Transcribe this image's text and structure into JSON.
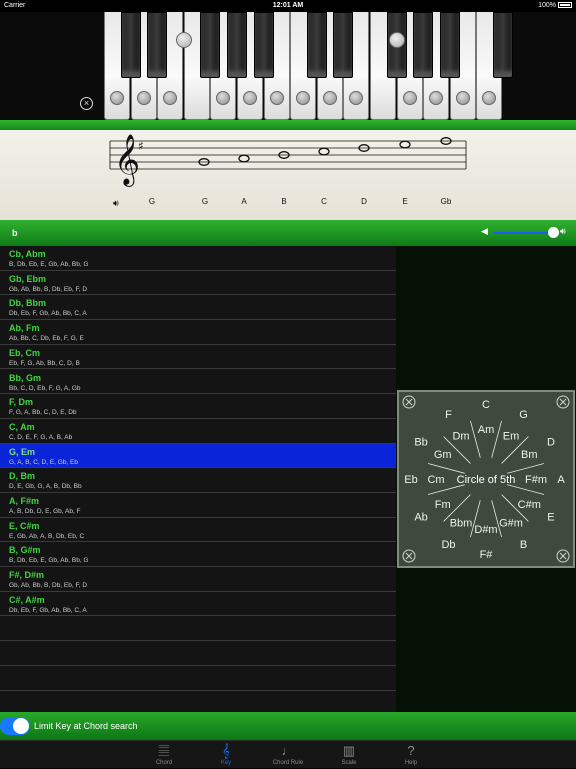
{
  "status_bar": {
    "carrier": "Carrier",
    "time": "12:01 AM",
    "battery": "100%"
  },
  "staff": {
    "notes": [
      "G",
      "G",
      "A",
      "B",
      "C",
      "D",
      "E",
      "Gb"
    ]
  },
  "key_bar": {
    "selected_key": "b"
  },
  "key_list": [
    {
      "title": "Cb, Abm",
      "notes": "B, Db, Eb, E, Gb, Ab, Bb, G",
      "selected": false
    },
    {
      "title": "Gb, Ebm",
      "notes": "Gb, Ab, Bb, B, Db, Eb, F, D",
      "selected": false
    },
    {
      "title": "Db, Bbm",
      "notes": "Db, Eb, F, Gb, Ab, Bb, C, A",
      "selected": false
    },
    {
      "title": "Ab, Fm",
      "notes": "Ab, Bb, C, Db, Eb, F, G, E",
      "selected": false
    },
    {
      "title": "Eb, Cm",
      "notes": "Eb, F, G, Ab, Bb, C, D, B",
      "selected": false
    },
    {
      "title": "Bb, Gm",
      "notes": "Bb, C, D, Eb, F, G, A, Gb",
      "selected": false
    },
    {
      "title": "F, Dm",
      "notes": "F, G, A, Bb, C, D, E, Db",
      "selected": false
    },
    {
      "title": "C, Am",
      "notes": "C, D, E, F, G, A, B, Ab",
      "selected": false
    },
    {
      "title": "G, Em",
      "notes": "G, A, B, C, D, E, Gb, Eb",
      "selected": true
    },
    {
      "title": "D, Bm",
      "notes": "D, E, Gb, G, A, B, Db, Bb",
      "selected": false
    },
    {
      "title": "A, F#m",
      "notes": "A, B, Db, D, E, Gb, Ab, F",
      "selected": false
    },
    {
      "title": "E, C#m",
      "notes": "E, Gb, Ab, A, B, Db, Eb, C",
      "selected": false
    },
    {
      "title": "B, G#m",
      "notes": "B, Db, Eb, E, Gb, Ab, Bb, G",
      "selected": false
    },
    {
      "title": "F#, D#m",
      "notes": "Gb, Ab, Bb, B, Db, Eb, F, D",
      "selected": false
    },
    {
      "title": "C#, A#m",
      "notes": "Db, Eb, F, Gb, Ab, Bb, C, A",
      "selected": false
    }
  ],
  "circle_of_fifths": {
    "title": "Circle of 5th",
    "major": [
      "C",
      "G",
      "D",
      "A",
      "E",
      "B",
      "F#",
      "Db",
      "Ab",
      "Eb",
      "Bb",
      "F"
    ],
    "minor": [
      "Am",
      "Em",
      "Bm",
      "F#m",
      "C#m",
      "G#m",
      "D#m",
      "Bbm",
      "Fm",
      "Cm",
      "Gm",
      "Dm"
    ]
  },
  "bottom_bar": {
    "toggle_label": "Limit Key at Chord search",
    "toggle_on": true
  },
  "tabs": [
    {
      "label": "Chord",
      "icon": "chord-icon",
      "active": false
    },
    {
      "label": "Key",
      "icon": "key-icon",
      "active": true
    },
    {
      "label": "Chord Rule",
      "icon": "chord-rule-icon",
      "active": false
    },
    {
      "label": "Scale",
      "icon": "scale-icon",
      "active": false
    },
    {
      "label": "Help",
      "icon": "help-icon",
      "active": false
    }
  ],
  "colors": {
    "accent_green": "#2fb62f",
    "selection_blue": "#0a25d8",
    "tab_active": "#1d6cff"
  }
}
